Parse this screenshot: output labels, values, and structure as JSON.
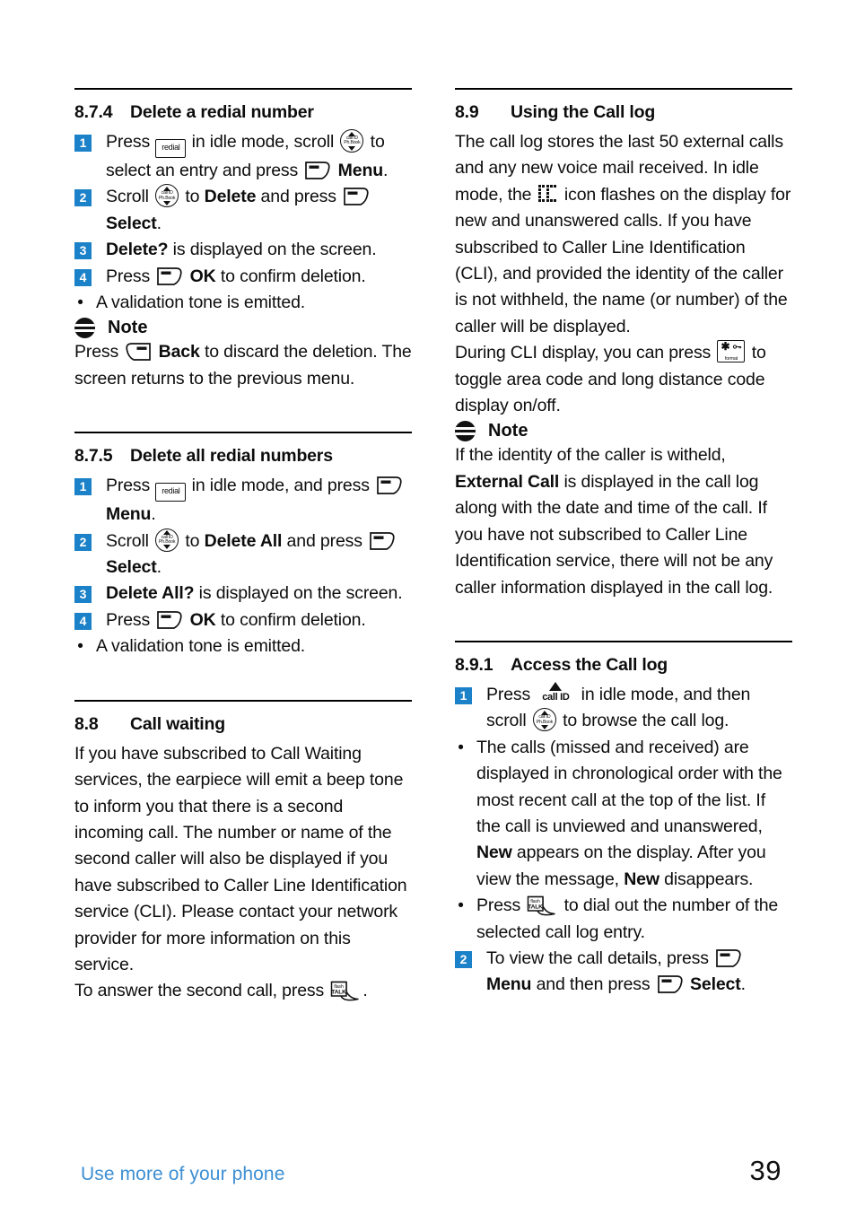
{
  "page": {
    "number": "39",
    "footer_label": "Use more of your phone",
    "accent_color": "#1b81c8",
    "footer_color": "#3d8fd3"
  },
  "icons": {
    "redial": "redial",
    "nav_top": "call ID",
    "nav_bottom": "Ph.Book",
    "talk_top": "flash",
    "talk_bottom": "TALK",
    "format_label": "format",
    "format_star": "✱",
    "callid_label": "call ID"
  },
  "left_column": {
    "section_874": {
      "number": "8.7.4",
      "title": "Delete a redial number",
      "steps": [
        {
          "n": "1",
          "parts": [
            {
              "t": "text",
              "v": "Press "
            },
            {
              "t": "icon",
              "v": "redial-key"
            },
            {
              "t": "text",
              "v": " in idle mode, scroll "
            },
            {
              "t": "icon",
              "v": "nav-key"
            },
            {
              "t": "text",
              "v": " to select an entry and press "
            },
            {
              "t": "icon",
              "v": "softkey-left"
            },
            {
              "t": "bold",
              "v": " Menu"
            },
            {
              "t": "text",
              "v": "."
            }
          ]
        },
        {
          "n": "2",
          "parts": [
            {
              "t": "text",
              "v": "Scroll "
            },
            {
              "t": "icon",
              "v": "nav-key"
            },
            {
              "t": "text",
              "v": " to "
            },
            {
              "t": "bold",
              "v": "Delete"
            },
            {
              "t": "text",
              "v": " and press "
            },
            {
              "t": "icon",
              "v": "softkey-left"
            },
            {
              "t": "bold",
              "v": " Select"
            },
            {
              "t": "text",
              "v": "."
            }
          ]
        },
        {
          "n": "3",
          "parts": [
            {
              "t": "bold",
              "v": "Delete?"
            },
            {
              "t": "text",
              "v": " is displayed on the screen."
            }
          ]
        },
        {
          "n": "4",
          "parts": [
            {
              "t": "text",
              "v": "Press "
            },
            {
              "t": "icon",
              "v": "softkey-left"
            },
            {
              "t": "bold",
              "v": " OK"
            },
            {
              "t": "text",
              "v": " to confirm deletion."
            }
          ]
        }
      ],
      "bullet": "A validation tone is emitted.",
      "note_label": "Note",
      "note_body_1": "Press ",
      "note_body_2": "Back",
      "note_body_3": " to discard the deletion. The screen returns to the previous menu."
    },
    "section_875": {
      "number": "8.7.5",
      "title": "Delete all redial numbers",
      "steps": [
        {
          "n": "1",
          "parts": [
            {
              "t": "text",
              "v": "Press "
            },
            {
              "t": "icon",
              "v": "redial-key"
            },
            {
              "t": "text",
              "v": " in idle mode, and press "
            },
            {
              "t": "icon",
              "v": "softkey-left"
            },
            {
              "t": "bold",
              "v": " Menu"
            },
            {
              "t": "text",
              "v": "."
            }
          ]
        },
        {
          "n": "2",
          "parts": [
            {
              "t": "text",
              "v": "Scroll "
            },
            {
              "t": "icon",
              "v": "nav-key"
            },
            {
              "t": "text",
              "v": " to "
            },
            {
              "t": "bold",
              "v": "Delete All"
            },
            {
              "t": "text",
              "v": " and press "
            },
            {
              "t": "icon",
              "v": "softkey-left"
            },
            {
              "t": "bold",
              "v": " Select"
            },
            {
              "t": "text",
              "v": "."
            }
          ]
        },
        {
          "n": "3",
          "parts": [
            {
              "t": "bold",
              "v": "Delete All?"
            },
            {
              "t": "text",
              "v": " is displayed on the screen."
            }
          ]
        },
        {
          "n": "4",
          "parts": [
            {
              "t": "text",
              "v": "Press "
            },
            {
              "t": "icon",
              "v": "softkey-left"
            },
            {
              "t": "bold",
              "v": " OK"
            },
            {
              "t": "text",
              "v": " to confirm deletion."
            }
          ]
        }
      ],
      "bullet": "A validation tone is emitted."
    },
    "section_88": {
      "number": "8.8",
      "title": "Call waiting",
      "paragraph": "If you have subscribed to Call Waiting services, the earpiece will emit a beep tone to inform you that there is a second incoming call. The number or name of the second caller will also be displayed if you have subscribed to Caller Line Identification service (CLI). Please contact your network provider for more information on this service.",
      "last_line_1": "To answer the second call, press ",
      "last_line_2": "."
    }
  },
  "right_column": {
    "section_89": {
      "number": "8.9",
      "title": "Using the Call log",
      "para_1a": "The call log stores the last 50 external calls and any new voice mail received. In idle mode, the ",
      "para_1b": " icon flashes on the display for new and unanswered calls. If you have subscribed to Caller Line Identification (CLI), and provided the identity of the caller is not withheld, the name (or number) of the caller will be displayed.",
      "para_2a": "During CLI display, you can press ",
      "para_2b": " to toggle area code and long distance code display on/off.",
      "note_label": "Note",
      "note_1": "If the identity of the caller is witheld, ",
      "note_bold": "External Call",
      "note_2": " is displayed in the call log along with the date and time of the call. If you have not subscribed to Caller Line Identification service, there will not be any caller information displayed in the call log."
    },
    "section_891": {
      "number": "8.9.1",
      "title": "Access the Call log",
      "step_1a": "Press ",
      "step_1b": " in idle mode, and then scroll ",
      "step_1c": " to browse the call log.",
      "bullet_1a": "The calls (missed and received) are displayed in chronological order with the most recent call at the top of the list. If the call is unviewed and unanswered, ",
      "bullet_1b": "New",
      "bullet_1c": " appears on the display. After you view the message, ",
      "bullet_1d": "New",
      "bullet_1e": " disappears.",
      "bullet_2a": "Press ",
      "bullet_2b": " to dial out the number of the selected call log entry.",
      "step_2a": "To view the call details, press ",
      "step_2b": " Menu",
      "step_2c": " and then press ",
      "step_2d": " Select",
      "step_2e": "."
    }
  }
}
